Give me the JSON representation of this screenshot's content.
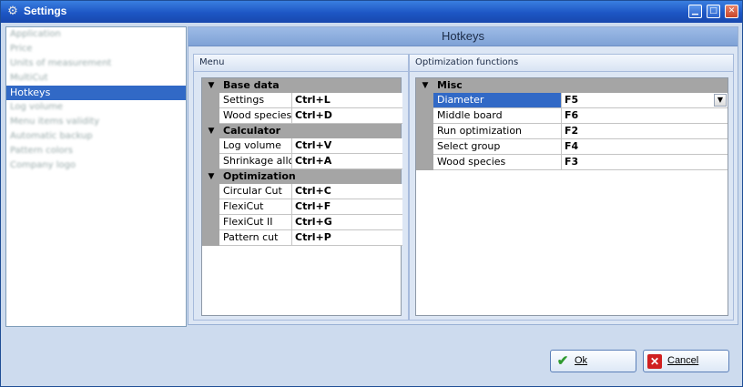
{
  "window": {
    "title": "Settings"
  },
  "sidebar": {
    "items": [
      {
        "label": "Application"
      },
      {
        "label": "Price"
      },
      {
        "label": "Units of measurement"
      },
      {
        "label": "MultiCut"
      },
      {
        "label": "Hotkeys",
        "active": true
      },
      {
        "label": "Log volume"
      },
      {
        "label": "Menu items validity"
      },
      {
        "label": "Automatic backup"
      },
      {
        "label": "Pattern colors"
      },
      {
        "label": "Company logo"
      }
    ]
  },
  "main": {
    "title": "Hotkeys",
    "menu": {
      "header": "Menu",
      "categories": [
        {
          "name": "Base data",
          "rows": [
            {
              "name": "Settings",
              "key": "Ctrl+L"
            },
            {
              "name": "Wood species",
              "key": "Ctrl+D"
            }
          ]
        },
        {
          "name": "Calculator",
          "rows": [
            {
              "name": "Log volume",
              "key": "Ctrl+V"
            },
            {
              "name": "Shrinkage allow",
              "key": "Ctrl+A"
            }
          ]
        },
        {
          "name": "Optimization",
          "rows": [
            {
              "name": "Circular Cut",
              "key": "Ctrl+C"
            },
            {
              "name": "FlexiCut",
              "key": "Ctrl+F"
            },
            {
              "name": "FlexiCut II",
              "key": "Ctrl+G"
            },
            {
              "name": "Pattern cut",
              "key": "Ctrl+P"
            }
          ]
        }
      ]
    },
    "optimization": {
      "header": "Optimization functions",
      "categories": [
        {
          "name": "Misc",
          "rows": [
            {
              "name": "Diameter",
              "key": "F5",
              "selected": true
            },
            {
              "name": "Middle board",
              "key": "F6"
            },
            {
              "name": "Run optimization",
              "key": "F2"
            },
            {
              "name": "Select group",
              "key": "F4"
            },
            {
              "name": "Wood species",
              "key": "F3"
            }
          ]
        }
      ]
    }
  },
  "buttons": {
    "ok": "Ok",
    "cancel": "Cancel"
  },
  "icons": {
    "settings": "gear-icon",
    "minimize": "minimize-icon",
    "maximize": "maximize-icon",
    "close": "close-icon",
    "ok": "checkmark-icon",
    "cancel": "cancel-x-icon",
    "expand": "chevron-down-icon",
    "dropdown": "dropdown-arrow-icon"
  },
  "colors": {
    "titlebar": "#1d56c4",
    "selection": "#3169c6",
    "category_bg": "#a5a5a5",
    "ok_icon": "#2f9a2f",
    "cancel_icon": "#d02020"
  }
}
